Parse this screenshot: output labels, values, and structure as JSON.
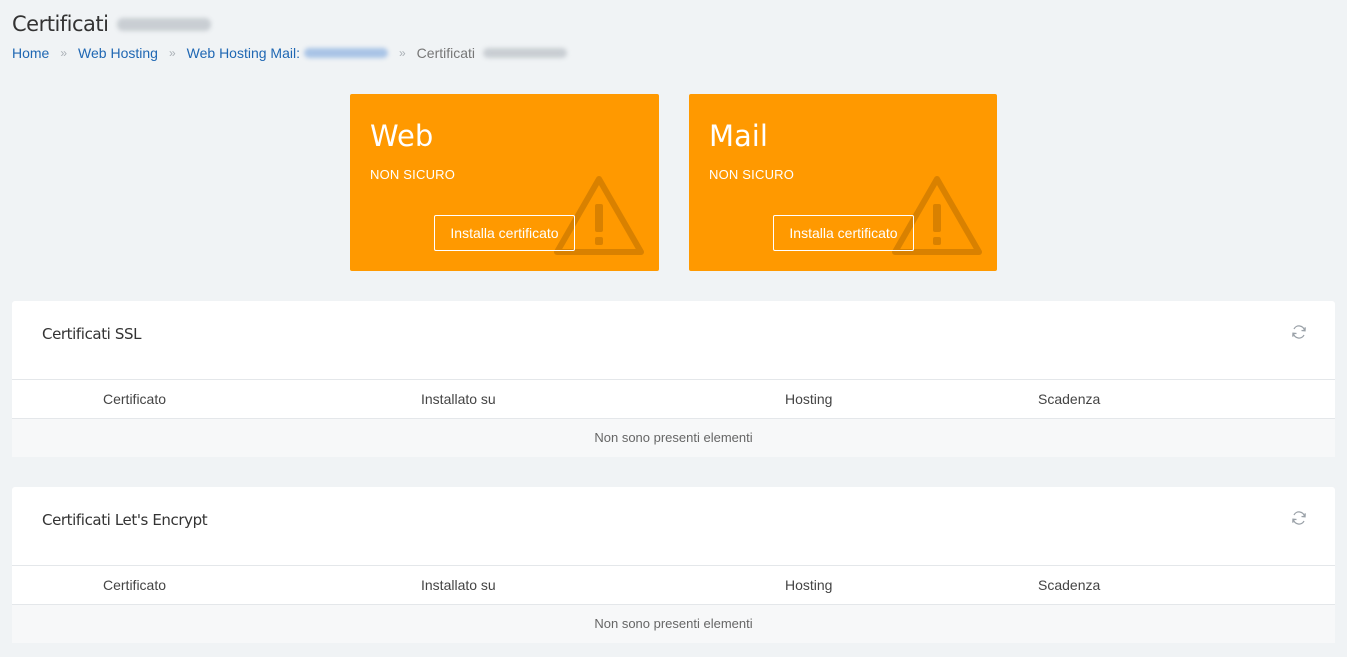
{
  "header": {
    "title": "Certificati"
  },
  "breadcrumb": {
    "home": "Home",
    "web_hosting": "Web Hosting",
    "web_hosting_mail": "Web Hosting Mail:",
    "current": "Certificati"
  },
  "cards": [
    {
      "title": "Web",
      "status": "NON SICURO",
      "button": "Installa certificato"
    },
    {
      "title": "Mail",
      "status": "NON SICURO",
      "button": "Installa certificato"
    }
  ],
  "colors": {
    "card_bg": "#ff9900",
    "link": "#1f67b3",
    "page_bg": "#f0f3f5"
  },
  "icons": {
    "card_icon": "warning-triangle-icon",
    "panel_action": "refresh-icon"
  },
  "panels": [
    {
      "title": "Certificati SSL",
      "columns": [
        "Certificato",
        "Installato su",
        "Hosting",
        "Scadenza"
      ],
      "empty": "Non sono presenti elementi"
    },
    {
      "title": "Certificati Let's Encrypt",
      "columns": [
        "Certificato",
        "Installato su",
        "Hosting",
        "Scadenza"
      ],
      "empty": "Non sono presenti elementi"
    }
  ]
}
